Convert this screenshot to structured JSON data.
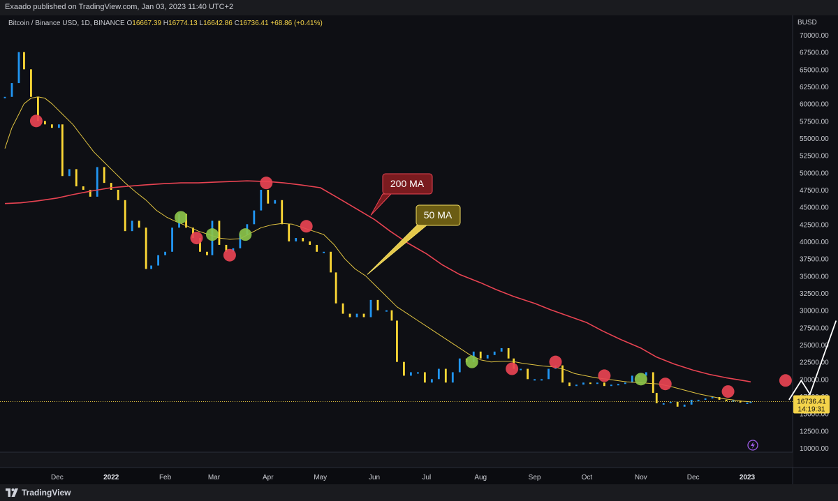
{
  "header": {
    "published": "Exaado published on TradingView.com, Jan 03, 2023 11:40 UTC+2"
  },
  "brand": {
    "name": "TradingView",
    "logo_icon": "tradingview-logo-icon"
  },
  "legend": {
    "symbol": "Bitcoin / Binance USD, 1D, BINANCE",
    "open_label": "O",
    "open": "16667.39",
    "high_label": "H",
    "high": "16774.13",
    "low_label": "L",
    "low": "16642.86",
    "close_label": "C",
    "close": "16736.41",
    "change": "+68.86 (+0.41%)"
  },
  "chart_data": {
    "type": "line",
    "quote_currency": "BUSD",
    "ylim": [
      10000,
      70000
    ],
    "y_ticks": [
      "10000.00",
      "12500.00",
      "15000.00",
      "17500.00",
      "20000.00",
      "22500.00",
      "25000.00",
      "27500.00",
      "30000.00",
      "32500.00",
      "35000.00",
      "37500.00",
      "40000.00",
      "42500.00",
      "45000.00",
      "47500.00",
      "50000.00",
      "52500.00",
      "55000.00",
      "57500.00",
      "60000.00",
      "62500.00",
      "65000.00",
      "67500.00",
      "70000.00"
    ],
    "x_ticks": [
      "Dec",
      "2022",
      "Feb",
      "Mar",
      "Apr",
      "May",
      "Jun",
      "Jul",
      "Aug",
      "Sep",
      "Oct",
      "Nov",
      "Dec",
      "2023"
    ],
    "last_price": "16736.41",
    "countdown": "14:19:31",
    "series": [
      {
        "name": "Bitcoin / Binance USD",
        "color": "#2196f3",
        "down_color": "#fdd835",
        "x": [
          "2021-11-01",
          "2021-11-05",
          "2021-11-09",
          "2021-11-12",
          "2021-11-16",
          "2021-11-20",
          "2021-11-24",
          "2021-11-28",
          "2021-12-02",
          "2021-12-04",
          "2021-12-08",
          "2021-12-12",
          "2021-12-16",
          "2021-12-20",
          "2021-12-24",
          "2021-12-28",
          "2022-01-01",
          "2022-01-05",
          "2022-01-09",
          "2022-01-13",
          "2022-01-17",
          "2022-01-21",
          "2022-01-24",
          "2022-01-28",
          "2022-02-01",
          "2022-02-05",
          "2022-02-09",
          "2022-02-13",
          "2022-02-17",
          "2022-02-21",
          "2022-02-25",
          "2022-02-28",
          "2022-03-04",
          "2022-03-08",
          "2022-03-12",
          "2022-03-16",
          "2022-03-20",
          "2022-03-24",
          "2022-03-28",
          "2022-04-01",
          "2022-04-05",
          "2022-04-09",
          "2022-04-13",
          "2022-04-17",
          "2022-04-21",
          "2022-04-25",
          "2022-04-29",
          "2022-05-03",
          "2022-05-07",
          "2022-05-10",
          "2022-05-14",
          "2022-05-18",
          "2022-05-22",
          "2022-05-26",
          "2022-05-30",
          "2022-06-03",
          "2022-06-08",
          "2022-06-11",
          "2022-06-14",
          "2022-06-18",
          "2022-06-22",
          "2022-06-26",
          "2022-06-30",
          "2022-07-04",
          "2022-07-08",
          "2022-07-12",
          "2022-07-16",
          "2022-07-20",
          "2022-07-24",
          "2022-07-28",
          "2022-08-01",
          "2022-08-05",
          "2022-08-09",
          "2022-08-13",
          "2022-08-17",
          "2022-08-20",
          "2022-08-24",
          "2022-08-28",
          "2022-09-01",
          "2022-09-05",
          "2022-09-09",
          "2022-09-13",
          "2022-09-17",
          "2022-09-21",
          "2022-09-25",
          "2022-09-29",
          "2022-10-03",
          "2022-10-07",
          "2022-10-11",
          "2022-10-15",
          "2022-10-19",
          "2022-10-23",
          "2022-10-27",
          "2022-10-31",
          "2022-11-04",
          "2022-11-08",
          "2022-11-10",
          "2022-11-14",
          "2022-11-18",
          "2022-11-22",
          "2022-11-26",
          "2022-11-30",
          "2022-12-04",
          "2022-12-08",
          "2022-12-12",
          "2022-12-16",
          "2022-12-20",
          "2022-12-24",
          "2022-12-28",
          "2023-01-01",
          "2023-01-03"
        ],
        "values": [
          61000,
          63000,
          67500,
          65000,
          61000,
          57500,
          57000,
          56500,
          57000,
          49500,
          50500,
          48000,
          47500,
          46500,
          50800,
          48500,
          47500,
          46000,
          41500,
          43000,
          42000,
          36000,
          36500,
          38000,
          38500,
          42000,
          44000,
          42000,
          40500,
          38500,
          38000,
          43000,
          39500,
          38500,
          39000,
          41000,
          42500,
          44500,
          47500,
          45500,
          46000,
          42500,
          40000,
          40500,
          40000,
          39500,
          38500,
          38500,
          35500,
          31000,
          29500,
          29000,
          29500,
          29000,
          31500,
          30000,
          30000,
          28500,
          22500,
          20500,
          21000,
          21000,
          19500,
          20000,
          21500,
          19500,
          21000,
          23000,
          22500,
          24000,
          23000,
          23500,
          24000,
          24500,
          23000,
          21500,
          21500,
          20000,
          20000,
          20000,
          21500,
          22000,
          19500,
          19000,
          19200,
          19500,
          19300,
          19500,
          19000,
          19200,
          19300,
          19500,
          20500,
          20500,
          21000,
          18000,
          16500,
          16500,
          16700,
          16000,
          16300,
          17000,
          17000,
          17200,
          17400,
          17000,
          16800,
          16900,
          16600,
          16600,
          16736
        ]
      },
      {
        "name": "50 MA",
        "color": "#e0c341",
        "x": [
          "2021-11-01",
          "2021-11-05",
          "2021-11-09",
          "2021-11-12",
          "2021-11-16",
          "2021-11-20",
          "2021-11-24",
          "2021-11-28",
          "2021-12-04",
          "2021-12-10",
          "2021-12-16",
          "2021-12-22",
          "2021-12-28",
          "2022-01-03",
          "2022-01-09",
          "2022-01-15",
          "2022-01-21",
          "2022-01-27",
          "2022-02-02",
          "2022-02-08",
          "2022-02-14",
          "2022-02-20",
          "2022-02-26",
          "2022-03-04",
          "2022-03-10",
          "2022-03-16",
          "2022-03-22",
          "2022-03-28",
          "2022-04-03",
          "2022-04-09",
          "2022-04-15",
          "2022-04-21",
          "2022-04-27",
          "2022-05-03",
          "2022-05-09",
          "2022-05-15",
          "2022-05-21",
          "2022-05-27",
          "2022-06-02",
          "2022-06-08",
          "2022-06-14",
          "2022-06-20",
          "2022-06-26",
          "2022-07-02",
          "2022-07-08",
          "2022-07-14",
          "2022-07-20",
          "2022-07-26",
          "2022-08-01",
          "2022-08-07",
          "2022-08-13",
          "2022-08-19",
          "2022-08-25",
          "2022-08-31",
          "2022-09-06",
          "2022-09-12",
          "2022-09-18",
          "2022-09-24",
          "2022-09-30",
          "2022-10-06",
          "2022-10-12",
          "2022-10-18",
          "2022-10-24",
          "2022-10-30",
          "2022-11-05",
          "2022-11-11",
          "2022-11-17",
          "2022-11-23",
          "2022-11-29",
          "2022-12-05",
          "2022-12-11",
          "2022-12-17",
          "2022-12-23",
          "2022-12-29",
          "2023-01-03"
        ],
        "values": [
          53500,
          56500,
          58500,
          60000,
          60800,
          61000,
          60800,
          60000,
          58500,
          57000,
          55000,
          53000,
          51500,
          50000,
          48500,
          47200,
          46000,
          44500,
          43500,
          42800,
          42200,
          41500,
          41000,
          40500,
          40300,
          40400,
          41200,
          42000,
          42400,
          42600,
          42500,
          42000,
          41500,
          41000,
          39500,
          37500,
          36000,
          35000,
          33500,
          32000,
          30500,
          29500,
          28500,
          27500,
          26500,
          25500,
          24500,
          23500,
          22800,
          22500,
          22600,
          22600,
          22300,
          22100,
          21900,
          21800,
          21400,
          20800,
          20500,
          20200,
          20000,
          19800,
          19600,
          19500,
          19400,
          19300,
          19000,
          18600,
          18200,
          17800,
          17500,
          17200,
          17000,
          16800,
          16700
        ]
      },
      {
        "name": "200 MA",
        "color": "#e84352",
        "x": [
          "2021-11-01",
          "2021-11-10",
          "2021-11-20",
          "2021-12-01",
          "2021-12-10",
          "2021-12-20",
          "2022-01-01",
          "2022-01-10",
          "2022-01-20",
          "2022-02-01",
          "2022-02-10",
          "2022-02-20",
          "2022-03-01",
          "2022-03-10",
          "2022-03-20",
          "2022-04-01",
          "2022-04-10",
          "2022-04-20",
          "2022-05-01",
          "2022-05-10",
          "2022-05-20",
          "2022-06-01",
          "2022-06-10",
          "2022-06-20",
          "2022-07-01",
          "2022-07-10",
          "2022-07-20",
          "2022-08-01",
          "2022-08-10",
          "2022-08-20",
          "2022-09-01",
          "2022-09-10",
          "2022-09-20",
          "2022-10-01",
          "2022-10-10",
          "2022-10-20",
          "2022-11-01",
          "2022-11-10",
          "2022-11-20",
          "2022-12-01",
          "2022-12-10",
          "2022-12-20",
          "2023-01-01",
          "2023-01-03"
        ],
        "values": [
          45500,
          45600,
          45900,
          46300,
          46800,
          47300,
          47800,
          48000,
          48200,
          48400,
          48500,
          48500,
          48600,
          48700,
          48800,
          48700,
          48500,
          48200,
          47800,
          46500,
          45000,
          43200,
          41500,
          39800,
          38200,
          36600,
          35200,
          34000,
          33000,
          32000,
          31000,
          30100,
          29200,
          28200,
          27000,
          25800,
          24500,
          23200,
          22200,
          21300,
          20700,
          20200,
          19700,
          19600
        ]
      }
    ],
    "annotations": [
      {
        "text": "200 MA",
        "series": "200 MA"
      },
      {
        "text": "50 MA",
        "series": "50 MA"
      }
    ],
    "markers": [
      {
        "x": "2021-11-19",
        "y": 57500,
        "color": "#e84352"
      },
      {
        "x": "2022-02-10",
        "y": 43500,
        "color": "#8bc34a"
      },
      {
        "x": "2022-02-19",
        "y": 40500,
        "color": "#e84352"
      },
      {
        "x": "2022-02-28",
        "y": 41000,
        "color": "#8bc34a"
      },
      {
        "x": "2022-03-10",
        "y": 38000,
        "color": "#e84352"
      },
      {
        "x": "2022-03-19",
        "y": 41000,
        "color": "#8bc34a"
      },
      {
        "x": "2022-03-31",
        "y": 48500,
        "color": "#e84352"
      },
      {
        "x": "2022-04-23",
        "y": 42200,
        "color": "#e84352"
      },
      {
        "x": "2022-07-27",
        "y": 22500,
        "color": "#8bc34a"
      },
      {
        "x": "2022-08-19",
        "y": 21500,
        "color": "#e84352"
      },
      {
        "x": "2022-09-13",
        "y": 22500,
        "color": "#e84352"
      },
      {
        "x": "2022-10-11",
        "y": 20500,
        "color": "#e84352"
      },
      {
        "x": "2022-11-01",
        "y": 20000,
        "color": "#8bc34a"
      },
      {
        "x": "2022-11-15",
        "y": 19300,
        "color": "#e84352"
      },
      {
        "x": "2022-12-21",
        "y": 18200,
        "color": "#e84352"
      },
      {
        "x": "2023-01-23",
        "y": 19800,
        "color": "#e84352"
      }
    ],
    "projection": {
      "x": [
        "2023-01-25",
        "2023-02-01",
        "2023-02-06",
        "2023-02-21"
      ],
      "values": [
        17000,
        19800,
        17800,
        28500
      ],
      "color": "#ffffff"
    },
    "indicator_icon": "lightning-icon",
    "grid": false
  }
}
